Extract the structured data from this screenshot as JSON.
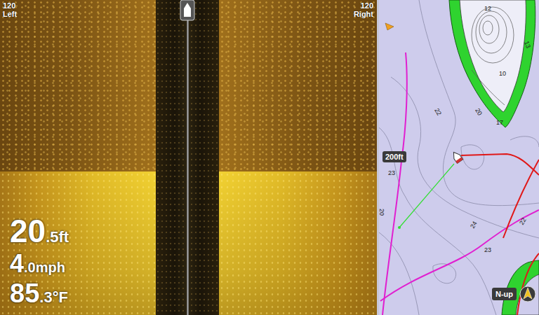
{
  "sonar": {
    "scan_sides": [
      {
        "range": "120",
        "side": "Left"
      },
      {
        "range": "120",
        "side": "Right"
      }
    ],
    "readouts": [
      {
        "whole": "20",
        "fraction": ".5",
        "unit": "ft"
      },
      {
        "whole": "4",
        "fraction": ".0",
        "unit": "mph"
      },
      {
        "whole": "85",
        "fraction": ".3",
        "unit": "°F"
      }
    ]
  },
  "chart": {
    "depth_labels": [
      "12",
      "13",
      "10",
      "20",
      "17",
      "22",
      "23",
      "24",
      "23",
      "22",
      "20"
    ],
    "scale": "200ft",
    "orientation": "N-up"
  }
}
